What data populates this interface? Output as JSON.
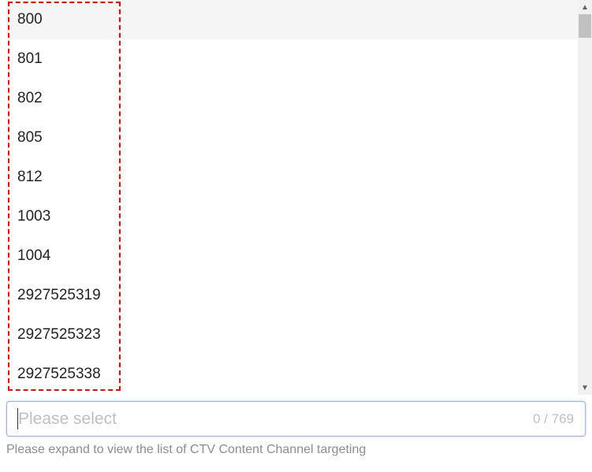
{
  "list": {
    "items": [
      {
        "label": "800"
      },
      {
        "label": "801"
      },
      {
        "label": "802"
      },
      {
        "label": "805"
      },
      {
        "label": "812"
      },
      {
        "label": "1003"
      },
      {
        "label": "1004"
      },
      {
        "label": "2927525319"
      },
      {
        "label": "2927525323"
      },
      {
        "label": "2927525338"
      }
    ]
  },
  "select": {
    "placeholder": "Please select",
    "counter": "0 / 769"
  },
  "hint": "Please expand to view the list of CTV Content Channel targeting",
  "icons": {
    "up": "▲",
    "down": "▼"
  }
}
